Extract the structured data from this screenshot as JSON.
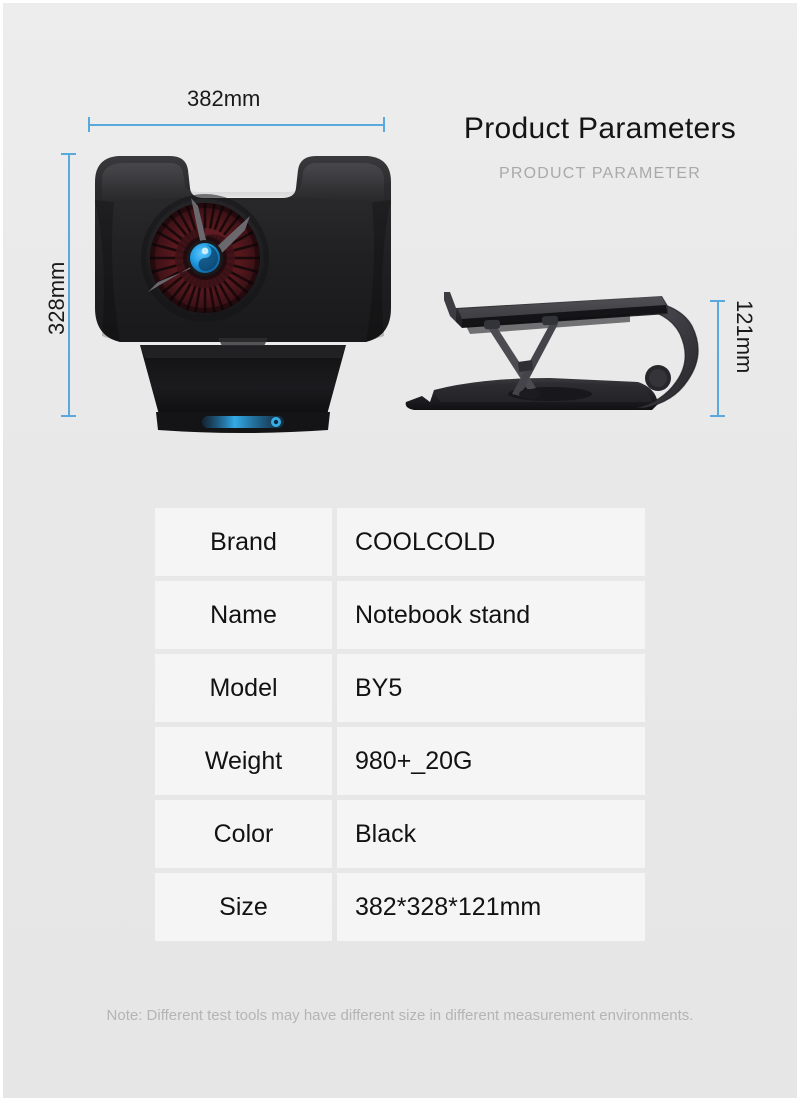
{
  "heading": {
    "title": "Product Parameters",
    "subtitle": "PRODUCT PARAMETER"
  },
  "dimensions": {
    "width_label": "382mm",
    "height_label": "328mm",
    "depth_label": "121mm"
  },
  "colors": {
    "accent_blue": "#5aa9dc",
    "background": "#e8e8e8",
    "cell_background": "#f5f5f5",
    "text": "#121212",
    "muted_text": "#b4b4b4",
    "product_body": "#1d1d1f",
    "fan_blade": "#5a1c20",
    "hub_blue": "#29a3e6"
  },
  "spec_table": {
    "rows": [
      {
        "label": "Brand",
        "value": "COOLCOLD"
      },
      {
        "label": "Name",
        "value": "Notebook stand"
      },
      {
        "label": "Model",
        "value": "BY5"
      },
      {
        "label": "Weight",
        "value": "980+_20G"
      },
      {
        "label": "Color",
        "value": " Black"
      },
      {
        "label": "Size",
        "value": "382*328*121mm"
      }
    ]
  },
  "note": "Note: Different test tools may have different size in different measurement environments.",
  "products": {
    "front_view_name": "laptop-cooling-stand-front-view",
    "side_view_name": "laptop-cooling-stand-side-view"
  }
}
